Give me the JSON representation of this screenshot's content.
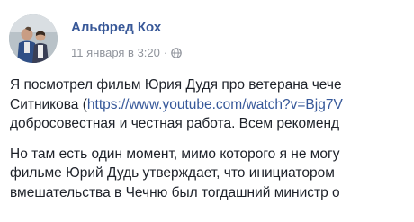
{
  "post": {
    "author": "Альфред Кох",
    "timestamp": "11 января в 3:20",
    "separator": "·",
    "privacy_icon": "globe-icon",
    "paragraph1": {
      "line1": "Я посмотрел фильм Юрия Дудя про ветерана чече",
      "line2_prefix": "Ситникова (",
      "link_text": "https://www.youtube.com/watch?v=Bjg7V",
      "line3": "добросовестная и честная работа. Всем рекоменд"
    },
    "paragraph2": {
      "line1": "Но там есть один момент, мимо которого я не могу",
      "line2": "фильме Юрий Дудь утверждает, что инициатором",
      "line3": "вмешательства в Чечню был тогдашний министр о"
    }
  },
  "colors": {
    "author": "#385898",
    "link": "#365899",
    "text": "#1d2129",
    "meta": "#90949c"
  }
}
